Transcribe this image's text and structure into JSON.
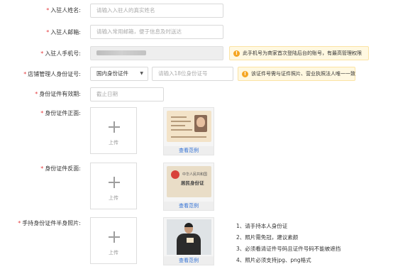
{
  "form": {
    "name": {
      "label": "入驻人姓名:",
      "placeholder": "请输入入驻人的真实姓名"
    },
    "email": {
      "label": "入驻人邮箱:",
      "placeholder": "请输入常用邮箱，便于信息及时送达"
    },
    "phone": {
      "label": "入驻人手机号:",
      "tip": "此手机号为商家首次登陆后台的账号，有最高管理权限"
    },
    "id_number": {
      "label": "店铺管理人身份证号:",
      "select_value": "国内身份证件",
      "placeholder": "请输入18位身份证号",
      "tip": "该证件号需与证件照片、营业执照法人唯一一致"
    },
    "id_validity": {
      "label": "身份证件有效期:",
      "placeholder": "截止日期"
    },
    "id_front": {
      "label": "身份证件正面:",
      "upload_label": "上传",
      "sample_label": "查看范例"
    },
    "id_back": {
      "label": "身份证件反面:",
      "upload_label": "上传",
      "sample_label": "查看范例",
      "card_line1": "中华人民共和国",
      "card_line2": "居民身份证"
    },
    "handheld": {
      "label": "手持身份证件半身照片:",
      "upload_label": "上传",
      "sample_label": "查看范例"
    },
    "required_mark": "*"
  },
  "handheld_hints": [
    "1、请手持本人身份证",
    "2、照片需免冠，建议素颜",
    "3、必须看清证件号码且证件号码不能被遮挡",
    "4、照片必须支持jpg、png格式"
  ],
  "colors": {
    "required": "#e4393c",
    "link": "#2f6fd4",
    "warn": "#f5a623",
    "tip_bg": "#fff8e1"
  }
}
